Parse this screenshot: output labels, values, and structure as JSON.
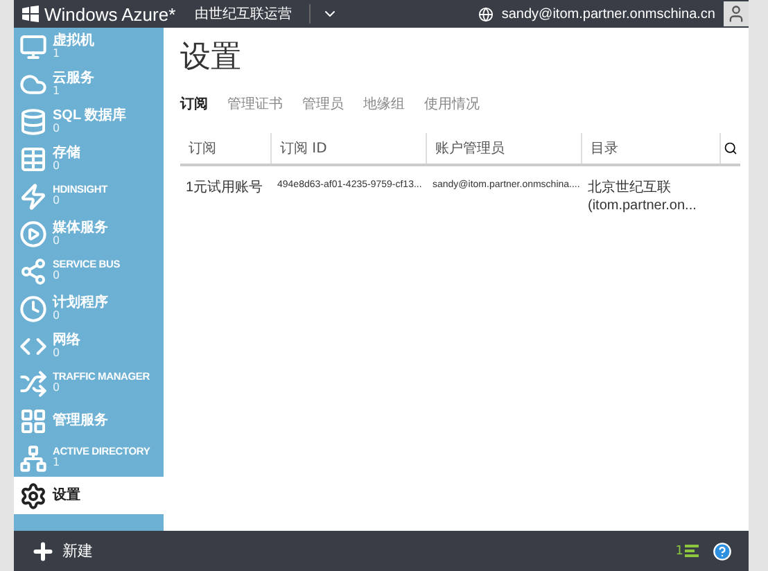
{
  "top_bar": {
    "brand": "Windows Azure*",
    "operator": "由世纪互联运营",
    "user": "sandy@itom.partner.onmschina.cn"
  },
  "sidebar": {
    "items": [
      {
        "kind": "vm",
        "label": "虚拟机",
        "count": "1",
        "selected": false
      },
      {
        "kind": "cloud",
        "label": "云服务",
        "count": "1",
        "selected": false
      },
      {
        "kind": "db",
        "label": "SQL 数据库",
        "count": "0",
        "selected": false
      },
      {
        "kind": "storage",
        "label": "存储",
        "count": "0",
        "selected": false
      },
      {
        "kind": "hd",
        "label": "HDINSIGHT",
        "count": "0",
        "selected": false
      },
      {
        "kind": "media",
        "label": "媒体服务",
        "count": "0",
        "selected": false
      },
      {
        "kind": "bus",
        "label": "SERVICE BUS",
        "count": "0",
        "selected": false
      },
      {
        "kind": "clock",
        "label": "计划程序",
        "count": "0",
        "selected": false
      },
      {
        "kind": "network",
        "label": "网络",
        "count": "0",
        "selected": false
      },
      {
        "kind": "traffic",
        "label": "TRAFFIC MANAGER",
        "count": "0",
        "selected": false
      },
      {
        "kind": "mgmt",
        "label": "管理服务",
        "selected": false
      },
      {
        "kind": "ad",
        "label": "ACTIVE DIRECTORY",
        "count": "1",
        "selected": false
      },
      {
        "kind": "settings",
        "label": "设置",
        "selected": true
      }
    ]
  },
  "page": {
    "title": "设置",
    "tabs": [
      {
        "label": "订阅",
        "selected": true
      },
      {
        "label": "管理证书",
        "selected": false
      },
      {
        "label": "管理员",
        "selected": false
      },
      {
        "label": "地缘组",
        "selected": false
      },
      {
        "label": "使用情况",
        "selected": false
      }
    ],
    "table": {
      "columns": [
        "订阅",
        "订阅 ID",
        "账户管理员",
        "目录"
      ],
      "rows": [
        [
          "1元试用账号",
          "494e8d63-af01-4235-9759-cf13...",
          "sandy@itom.partner.onmschina....",
          "北京世纪互联 (itom.partner.on..."
        ]
      ]
    }
  },
  "bottom_bar": {
    "new_label": "新建",
    "notification_count": "1"
  }
}
